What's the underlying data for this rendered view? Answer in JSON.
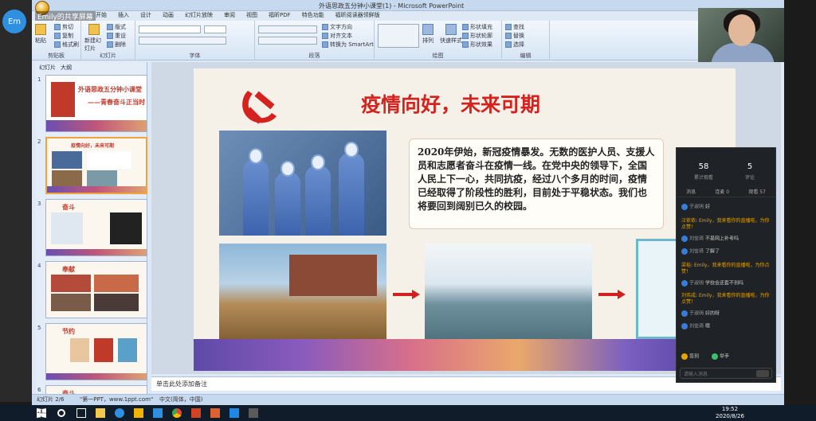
{
  "meeting": {
    "avatar_initials": "Em",
    "presenter_name": "Emily的共享屏幕"
  },
  "window": {
    "title": "外语思政五分钟小课堂(1) - Microsoft PowerPoint"
  },
  "ribbon": {
    "tabs": [
      "开始",
      "插入",
      "设计",
      "动画",
      "幻灯片放映",
      "审阅",
      "视图",
      "福昕PDF",
      "特色功能",
      "福昕阅读器领鲜版"
    ],
    "groups": [
      "剪贴板",
      "幻灯片",
      "字体",
      "段落",
      "绘图",
      "编辑"
    ],
    "buttons": {
      "paste": "粘贴",
      "cut": "剪切",
      "copy": "复制",
      "format_painter": "格式刷",
      "new_slide": "新建幻灯片",
      "layout": "版式",
      "reset": "重设",
      "delete": "删除",
      "text_direction": "文字方向",
      "align_text": "对齐文本",
      "smartart": "转换为 SmartArt",
      "arrange": "排列",
      "quick_styles": "快速样式",
      "shape_fill": "形状填充",
      "shape_outline": "形状轮廓",
      "shape_effects": "形状效果",
      "find": "查找",
      "replace": "替换",
      "select": "选择"
    }
  },
  "panel": {
    "tabs": [
      "幻灯片",
      "大纲"
    ]
  },
  "thumbnails": [
    {
      "num": "1",
      "title": "外语思政五分钟小课堂",
      "sub": "——青春奋斗正当时"
    },
    {
      "num": "2",
      "title": "疫情向好，未来可期",
      "sub": ""
    },
    {
      "num": "3",
      "title": "奋斗",
      "sub": ""
    },
    {
      "num": "4",
      "title": "奉献",
      "sub": ""
    },
    {
      "num": "5",
      "title": "节约",
      "sub": ""
    },
    {
      "num": "6",
      "title": "奋斗",
      "sub": ""
    }
  ],
  "slide": {
    "title": "疫情向好，未来可期",
    "body": "2020年伊始，新冠疫情暴发。无数的医护人员、支援人员和志愿者奋斗在疫情一线。在党中央的领导下，全国人民上下一心，共同抗疫，经过八个多月的时间，疫情已经取得了阶段性的胜利，目前处于平稳状态。我们也将要回到阔别已久的校园。"
  },
  "notes": {
    "placeholder": "单击此处添加备注"
  },
  "status": {
    "slide_info": "幻灯片 2/6",
    "theme": "\"第一PPT，www.1ppt.com\"",
    "lang": "中文(简体，中国)"
  },
  "chat": {
    "stats": [
      {
        "value": "58",
        "label": "累计观看"
      },
      {
        "value": "5",
        "label": "评论"
      }
    ],
    "tabs": [
      "消息",
      "连麦 0",
      "观看 57"
    ],
    "messages": [
      {
        "name": "于淑明",
        "text": "好",
        "style": "gray"
      },
      {
        "name": "汪依依",
        "text": "Emily，我来看你的直播啦，为你点赞！",
        "style": "orange"
      },
      {
        "name": "刘佳琦",
        "text": "不是网上补考吗",
        "style": "gray"
      },
      {
        "name": "刘佳琦",
        "text": "了解了",
        "style": "gray"
      },
      {
        "name": "梁裕",
        "text": "Emily，我来看你的直播啦，为你点赞！",
        "style": "orange"
      },
      {
        "name": "于淑明",
        "text": "学校会还套不到吗",
        "style": "gray"
      },
      {
        "name": "刘伟成",
        "text": "Emily，我来看你的直播啦，为你点赞！",
        "style": "orange"
      },
      {
        "name": "于淑明",
        "text": "好的呀",
        "style": "gray"
      },
      {
        "name": "刘佳琦",
        "text": "嗯",
        "style": "gray"
      }
    ],
    "actions": [
      "签到",
      "举手"
    ],
    "input_placeholder": "请输入消息"
  },
  "clock": {
    "time": "19:52",
    "date": "2020/8/26"
  },
  "colors": {
    "accent_red": "#d4231f",
    "chat_orange": "#e6a400",
    "ribbon": "#dfe9f5"
  }
}
